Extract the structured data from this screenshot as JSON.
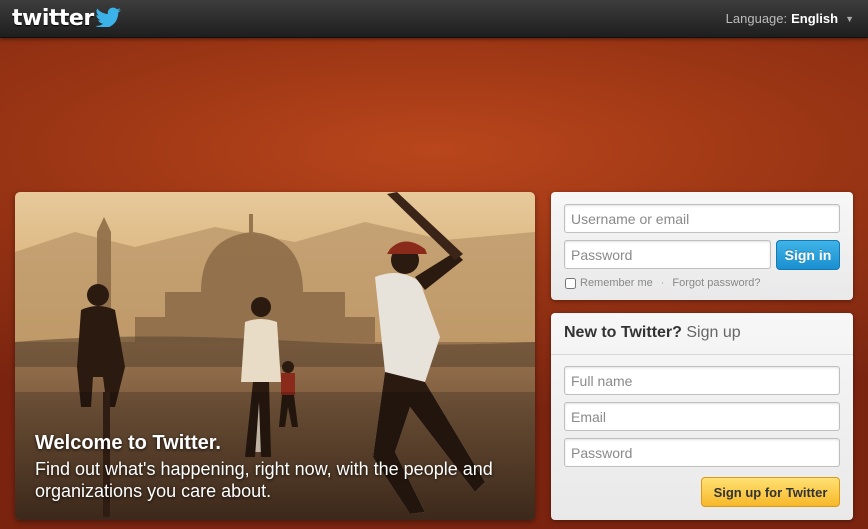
{
  "header": {
    "logo_text": "twitter",
    "language_label": "Language:",
    "language_value": "English"
  },
  "hero": {
    "title": "Welcome to Twitter.",
    "subtitle": "Find out what's happening, right now, with the people and organizations you care about."
  },
  "signin": {
    "username_placeholder": "Username or email",
    "password_placeholder": "Password",
    "button_label": "Sign in",
    "remember_label": "Remember me",
    "separator": "·",
    "forgot_label": "Forgot password?"
  },
  "signup": {
    "heading_bold": "New to Twitter?",
    "heading_normal": "Sign up",
    "fullname_placeholder": "Full name",
    "email_placeholder": "Email",
    "password_placeholder": "Password",
    "button_label": "Sign up for Twitter"
  },
  "colors": {
    "background": "#9a3514",
    "signin_button": "#1a8fd0",
    "signup_button": "#f7b82a"
  },
  "icons": {
    "logo_bird": "bird-icon",
    "language_caret": "caret-down-icon"
  }
}
